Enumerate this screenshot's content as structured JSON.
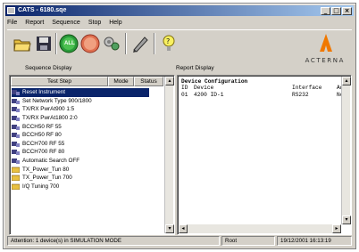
{
  "window": {
    "title": "CATS - 6180.sqe",
    "controls": [
      "_",
      "□",
      "×"
    ]
  },
  "menu": [
    "File",
    "Report",
    "Sequence",
    "Stop",
    "Help"
  ],
  "toolbar": {
    "run_label": "ALL",
    "icons": [
      "open-folder-icon",
      "save-disk-icon",
      "run-all-icon",
      "stop-icon",
      "settings-icon",
      "edit-icon",
      "help-icon"
    ]
  },
  "brand": {
    "logo_text": "ACTERNA",
    "color": "#f07800"
  },
  "sequence": {
    "label": "Sequence Display",
    "columns": [
      "Test Step",
      "Mode",
      "Status"
    ],
    "items": [
      {
        "label": "Reset Instrument",
        "type": "instrument",
        "selected": true
      },
      {
        "label": "Set Network Type 900/1800",
        "type": "instrument"
      },
      {
        "label": "TX/RX PwrAt900 1:5",
        "type": "instrument"
      },
      {
        "label": "TX/RX PwrAt1800 2:0",
        "type": "instrument"
      },
      {
        "label": "BCCH50 RF 55",
        "type": "instrument"
      },
      {
        "label": "BCCH50 RF 80",
        "type": "instrument"
      },
      {
        "label": "BCCH700 RF 55",
        "type": "instrument"
      },
      {
        "label": "BCCH700 RF 80",
        "type": "instrument"
      },
      {
        "label": "Automatic Search OFF",
        "type": "instrument"
      },
      {
        "label": "TX_Power_Tun 80",
        "type": "folder"
      },
      {
        "label": "TX_Power_Tun 700",
        "type": "folder"
      },
      {
        "label": "I/Q Tuning 700",
        "type": "folder"
      }
    ]
  },
  "report": {
    "label": "Report Display",
    "title": "Device Configuration",
    "columns": [
      "ID",
      "Device",
      "Interface",
      "Ad"
    ],
    "row": {
      "id": "01",
      "device": "4200 ID-1",
      "interface": "RS232",
      "addr": "No"
    }
  },
  "status": {
    "message": "Attention: 1 device(s) in SIMULATION MODE",
    "user": "Root",
    "datetime": "19/12/2001 16:13:19"
  }
}
